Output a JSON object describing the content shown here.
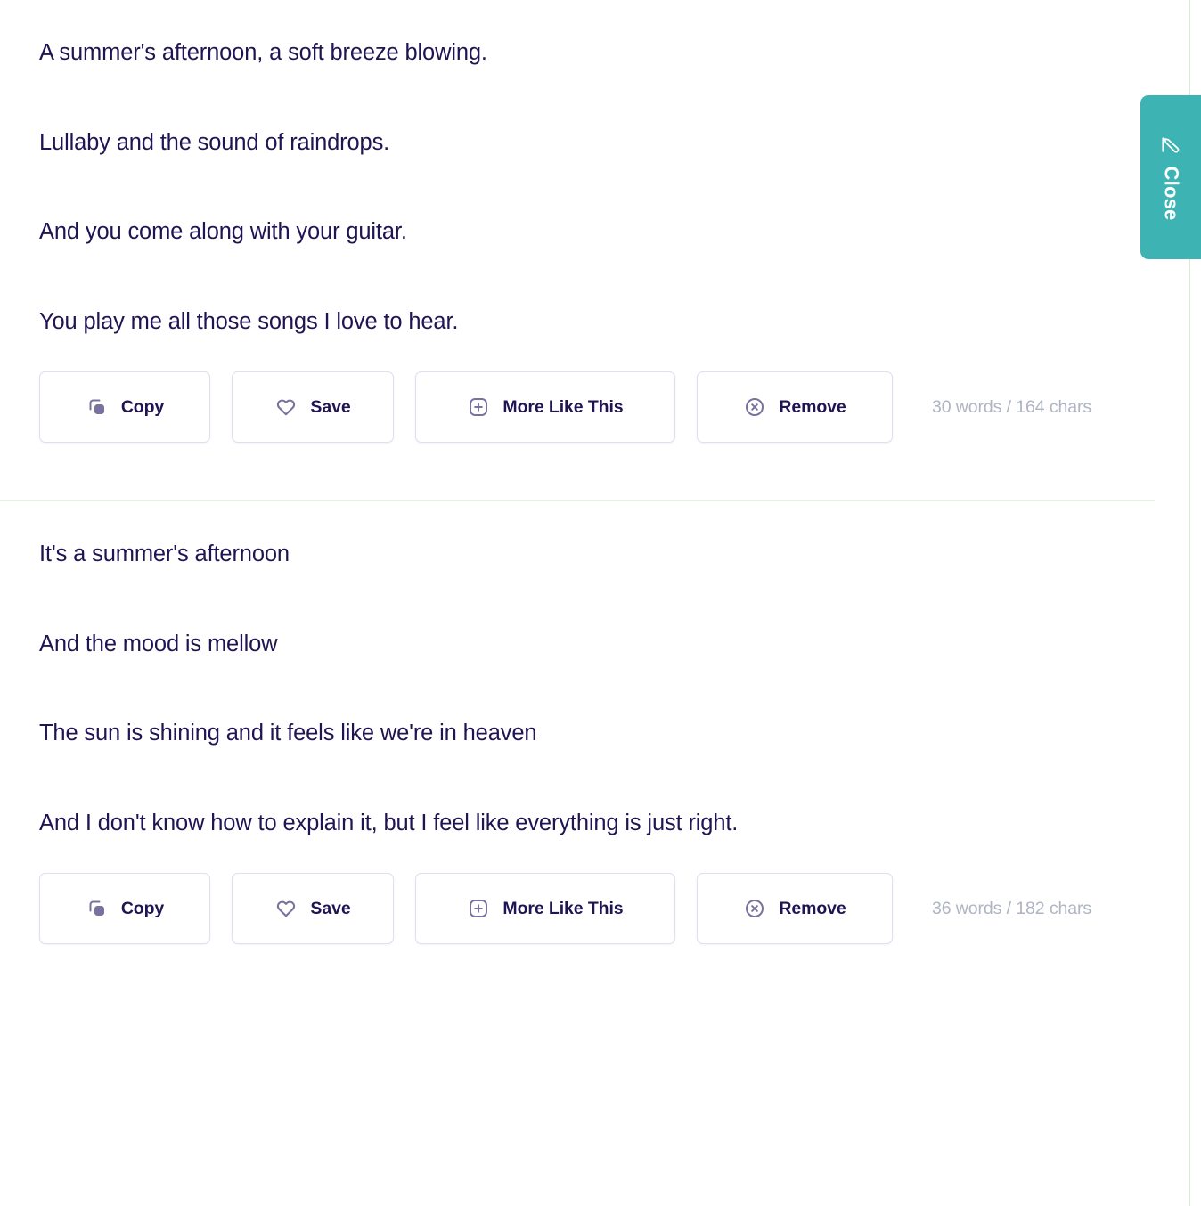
{
  "close_tab": {
    "label": "Close",
    "icon": "pencil-edit-icon",
    "color": "#3eb3b3"
  },
  "theme": {
    "text_color": "#211452",
    "muted_text_color": "#aeb4c2",
    "button_border_color": "#e0def0",
    "icon_color": "#7a719e",
    "divider_color": "#e7efe7",
    "accent_color": "#3eb3b3",
    "background": "#ffffff"
  },
  "actions": [
    {
      "id": "copy",
      "label": "Copy",
      "icon": "copy-icon"
    },
    {
      "id": "save",
      "label": "Save",
      "icon": "heart-icon"
    },
    {
      "id": "more",
      "label": "More Like This",
      "icon": "plus-square-icon"
    },
    {
      "id": "remove",
      "label": "Remove",
      "icon": "close-circle-icon"
    }
  ],
  "results": [
    {
      "lines": [
        "A summer's afternoon, a soft breeze blowing.",
        "Lullaby and the sound of raindrops.",
        "And you come along with your guitar.",
        "You play me all those songs I love to hear."
      ],
      "stats": "30 words / 164 chars"
    },
    {
      "lines": [
        "It's a summer's afternoon",
        "And the mood is mellow",
        "The sun is shining and it feels like we're in heaven",
        "And I don't know how to explain it, but I feel like everything is just right."
      ],
      "stats": "36 words / 182 chars"
    }
  ]
}
